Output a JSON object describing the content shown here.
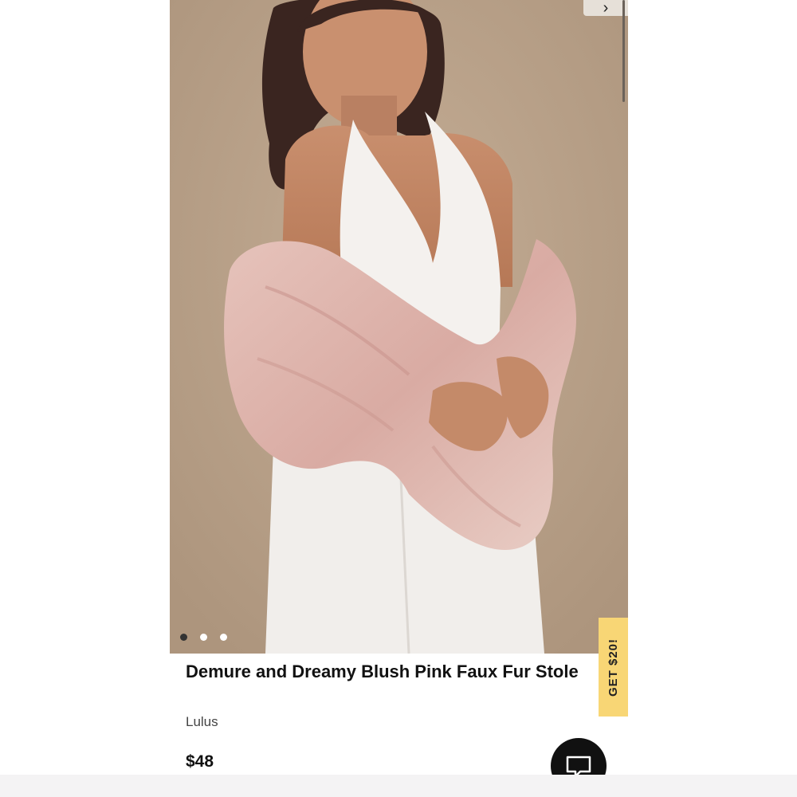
{
  "product": {
    "title": "Demure and Dreamy Blush Pink Faux Fur Stole",
    "brand": "Lulus",
    "price": "$48",
    "image_count": 3,
    "active_image_index": 1
  },
  "promo": {
    "label": "GET $20!"
  },
  "icons": {
    "next_image": "chevron-right-icon",
    "chat": "chat-icon"
  },
  "colors": {
    "background": "#b79f87",
    "promo": "#f8d675",
    "chat_button": "#111111"
  }
}
